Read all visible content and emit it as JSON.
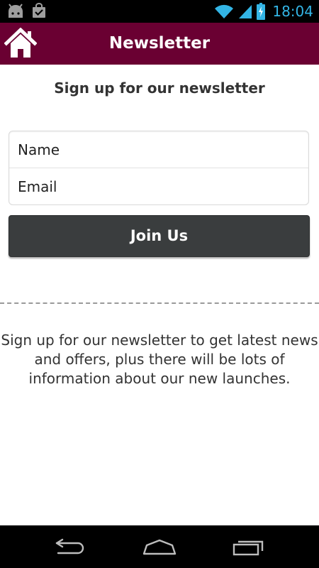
{
  "status_bar": {
    "time": "18:04",
    "icons": [
      "android-icon",
      "shopping-bag-icon",
      "wifi-icon",
      "signal-icon",
      "battery-icon"
    ],
    "time_color": "#33b5e5"
  },
  "app_bar": {
    "title": "Newsletter",
    "background_color": "#6a0032",
    "home_icon": "home-icon"
  },
  "signup": {
    "heading": "Sign up for our newsletter",
    "name_placeholder": "Name",
    "email_placeholder": "Email",
    "join_label": "Join Us",
    "button_color": "#3a3d3e"
  },
  "info": {
    "text": "Sign up for our newsletter to get latest news and offers, plus there will be lots of information about our new launches."
  },
  "nav_bar": {
    "icons": [
      "back-icon",
      "home-nav-icon",
      "recents-icon"
    ]
  }
}
